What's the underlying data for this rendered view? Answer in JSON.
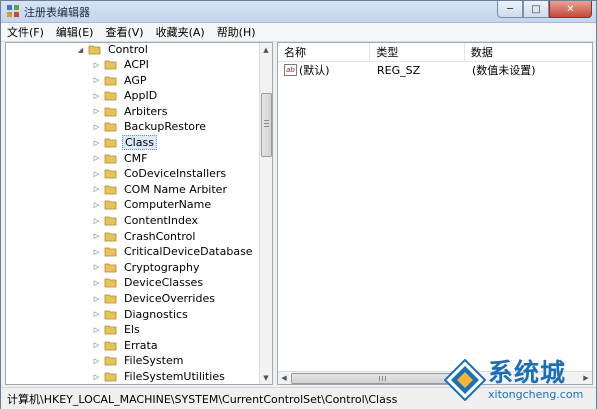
{
  "window": {
    "title": "注册表编辑器",
    "buttons": {
      "minimize": "─",
      "maximize": "□",
      "close": "✕"
    }
  },
  "menu": {
    "items": [
      "文件(F)",
      "编辑(E)",
      "查看(V)",
      "收藏夹(A)",
      "帮助(H)"
    ]
  },
  "tree": {
    "parent": "Control",
    "children": [
      "ACPI",
      "AGP",
      "AppID",
      "Arbiters",
      "BackupRestore",
      "Class",
      "CMF",
      "CoDeviceInstallers",
      "COM Name Arbiter",
      "ComputerName",
      "ContentIndex",
      "CrashControl",
      "CriticalDeviceDatabase",
      "Cryptography",
      "DeviceClasses",
      "DeviceOverrides",
      "Diagnostics",
      "Els",
      "Errata",
      "FileSystem",
      "FileSystemUtilities"
    ],
    "selected": "Class"
  },
  "list": {
    "columns": [
      "名称",
      "类型",
      "数据"
    ],
    "rows": [
      {
        "name": "(默认)",
        "type": "REG_SZ",
        "data": "(数值未设置)",
        "icon": "string-value-icon"
      }
    ]
  },
  "status": {
    "path": "计算机\\HKEY_LOCAL_MACHINE\\SYSTEM\\CurrentControlSet\\Control\\Class"
  },
  "watermark": {
    "brand": "系统城",
    "url": "xitongcheng.com"
  },
  "colors": {
    "folder": "#e8c25a",
    "selection": "#ddeaf9",
    "watermark": "#1a6fb8"
  }
}
